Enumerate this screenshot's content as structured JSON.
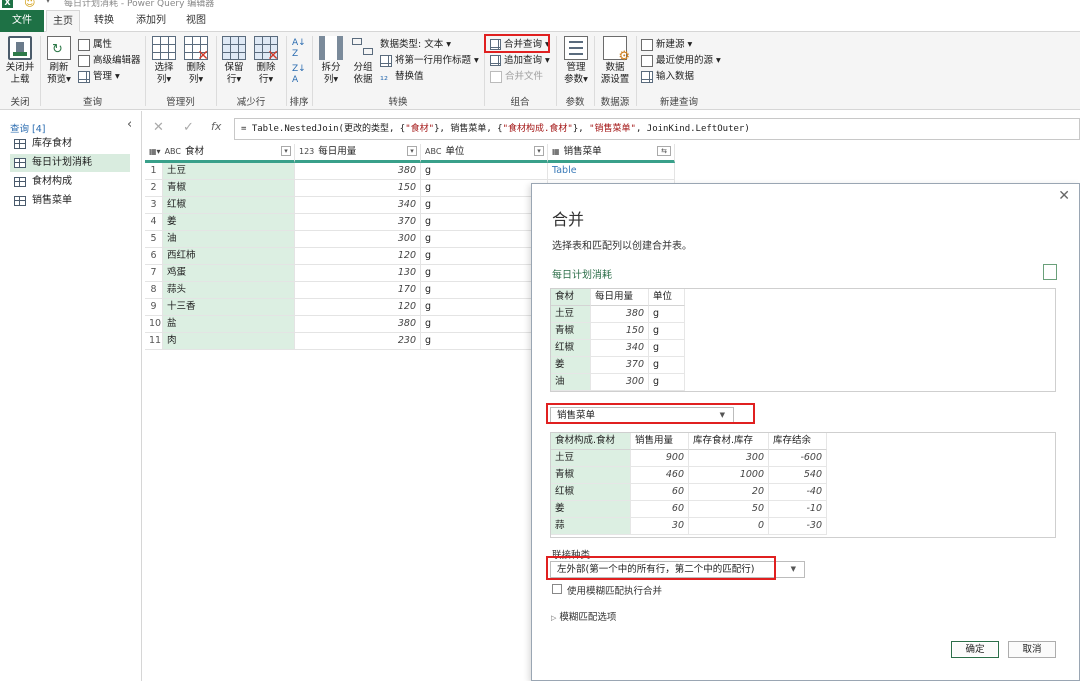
{
  "window": {
    "title": "每日计划消耗 - Power Query 编辑器",
    "excel_icon_label": "X"
  },
  "tabs": [
    "文件",
    "主页",
    "转换",
    "添加列",
    "视图"
  ],
  "ribbon": {
    "close_load": [
      "关闭并",
      "上载"
    ],
    "refresh": [
      "刷新",
      "预览"
    ],
    "properties": "属性",
    "advanced_editor": "高级编辑器",
    "manage": "管理",
    "choose_cols": [
      "选择",
      "列"
    ],
    "remove_cols": [
      "删除",
      "列"
    ],
    "keep_rows": [
      "保留",
      "行"
    ],
    "remove_rows": [
      "删除",
      "行"
    ],
    "split_col": [
      "拆分",
      "列"
    ],
    "group_by": [
      "分组",
      "依据"
    ],
    "data_type": "数据类型: 文本",
    "use_first_row": "将第一行用作标题",
    "replace_values": "替换值",
    "merge_queries": "合并查询",
    "append_queries": "追加查询",
    "combine_files": "合并文件",
    "manage_params": [
      "管理",
      "参数"
    ],
    "datasource_settings": [
      "数据",
      "源设置"
    ],
    "new_source": "新建源",
    "recent_sources": "最近使用的源",
    "enter_data": "输入数据",
    "groups": {
      "close": "关闭",
      "query": "查询",
      "manage_cols": "管理列",
      "reduce_rows": "减少行",
      "sort": "排序",
      "transform": "转换",
      "combine": "组合",
      "params": "参数",
      "datasource": "数据源",
      "new_query": "新建查询"
    }
  },
  "queries_panel": {
    "header": "查询 [4]",
    "items": [
      "库存食材",
      "每日计划消耗",
      "食材构成",
      "销售菜单"
    ],
    "selected_index": 1
  },
  "formula": {
    "prefix": "= Table.NestedJoin(更改的类型, {",
    "s1": "\"食材\"",
    "mid1": "}, 销售菜单, {",
    "s2": "\"食材构成.食材\"",
    "mid2": "}, ",
    "s3": "\"销售菜单\"",
    "suffix": ", JoinKind.LeftOuter)"
  },
  "main_grid": {
    "columns": [
      {
        "type": "ABC",
        "name": "食材"
      },
      {
        "type": "123",
        "name": "每日用量"
      },
      {
        "type": "ABC",
        "name": "单位"
      },
      {
        "type": "table",
        "name": "销售菜单"
      }
    ],
    "rows": [
      [
        "1",
        "土豆",
        "380",
        "g",
        "Table"
      ],
      [
        "2",
        "青椒",
        "150",
        "g",
        ""
      ],
      [
        "3",
        "红椒",
        "340",
        "g",
        ""
      ],
      [
        "4",
        "姜",
        "370",
        "g",
        ""
      ],
      [
        "5",
        "油",
        "300",
        "g",
        ""
      ],
      [
        "6",
        "西红柿",
        "120",
        "g",
        ""
      ],
      [
        "7",
        "鸡蛋",
        "130",
        "g",
        ""
      ],
      [
        "8",
        "蒜头",
        "170",
        "g",
        ""
      ],
      [
        "9",
        "十三香",
        "120",
        "g",
        ""
      ],
      [
        "10",
        "盐",
        "380",
        "g",
        ""
      ],
      [
        "11",
        "肉",
        "230",
        "g",
        ""
      ]
    ]
  },
  "dialog": {
    "title": "合并",
    "subtitle": "选择表和匹配列以创建合并表。",
    "first_table_name": "每日计划消耗",
    "preview1": {
      "headers": [
        "食材",
        "每日用量",
        "单位"
      ],
      "rows": [
        [
          "土豆",
          "380",
          "g"
        ],
        [
          "青椒",
          "150",
          "g"
        ],
        [
          "红椒",
          "340",
          "g"
        ],
        [
          "姜",
          "370",
          "g"
        ],
        [
          "油",
          "300",
          "g"
        ]
      ]
    },
    "second_table_select": "销售菜单",
    "preview2": {
      "headers": [
        "食材构成.食材",
        "销售用量",
        "库存食材.库存",
        "库存结余"
      ],
      "rows": [
        [
          "土豆",
          "900",
          "300",
          "-600"
        ],
        [
          "青椒",
          "460",
          "1000",
          "540"
        ],
        [
          "红椒",
          "60",
          "20",
          "-40"
        ],
        [
          "姜",
          "60",
          "50",
          "-10"
        ],
        [
          "蒜",
          "30",
          "0",
          "-30"
        ]
      ]
    },
    "join_kind_label": "联接种类",
    "join_kind_value": "左外部(第一个中的所有行，第二个中的匹配行)",
    "fuzzy_checkbox": "使用模糊匹配执行合并",
    "fuzzy_options": "模糊匹配选项",
    "ok": "确定",
    "cancel": "取消"
  }
}
